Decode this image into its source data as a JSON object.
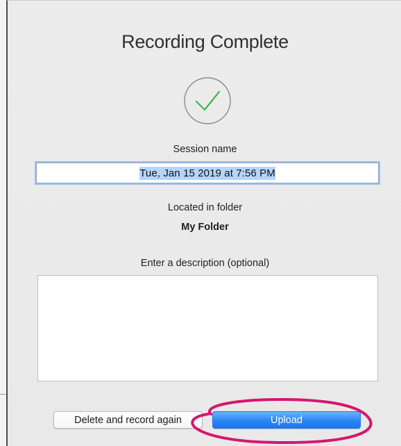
{
  "dialog": {
    "title": "Recording Complete",
    "status_icon": "checkmark-circle-icon",
    "session": {
      "label": "Session name",
      "value": "Tue, Jan 15 2019 at 7:56 PM"
    },
    "folder": {
      "label": "Located in folder",
      "name": "My Folder"
    },
    "description": {
      "label": "Enter a description (optional)",
      "value": "",
      "placeholder": ""
    },
    "buttons": {
      "delete_label": "Delete and record again",
      "upload_label": "Upload"
    }
  },
  "colors": {
    "check": "#43b34a",
    "upload_button": "#2a86f5",
    "selection": "#b4d5fe",
    "focus_ring": "#9dc0e8",
    "annotation": "#d6176e"
  }
}
